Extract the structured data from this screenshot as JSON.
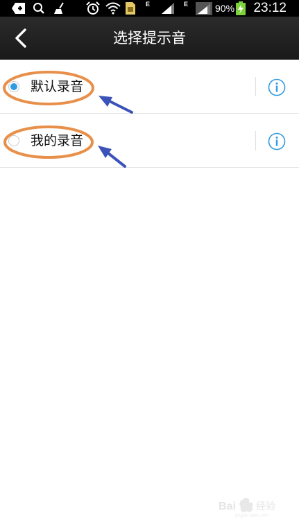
{
  "status_bar": {
    "battery_percent": "90%",
    "time": "23:12",
    "network_type": "E",
    "icons": [
      "add-box-icon",
      "search-icon",
      "broom-icon",
      "alarm-icon",
      "wifi-icon",
      "sim-card-icon",
      "signal-icon",
      "signal-icon",
      "battery-charging-icon"
    ]
  },
  "header": {
    "title": "选择提示音",
    "back_icon": "chevron-left-icon"
  },
  "ringtones": {
    "items": [
      {
        "label": "默认录音",
        "selected": true,
        "info_icon": "info-circle-icon"
      },
      {
        "label": "我的录音",
        "selected": false,
        "info_icon": "info-circle-icon"
      }
    ]
  },
  "annotations": {
    "highlight_color": "#e8904a",
    "arrow_color": "#3b53b8"
  },
  "colors": {
    "accent": "#2f9be0",
    "header_bg": "#222222"
  }
}
